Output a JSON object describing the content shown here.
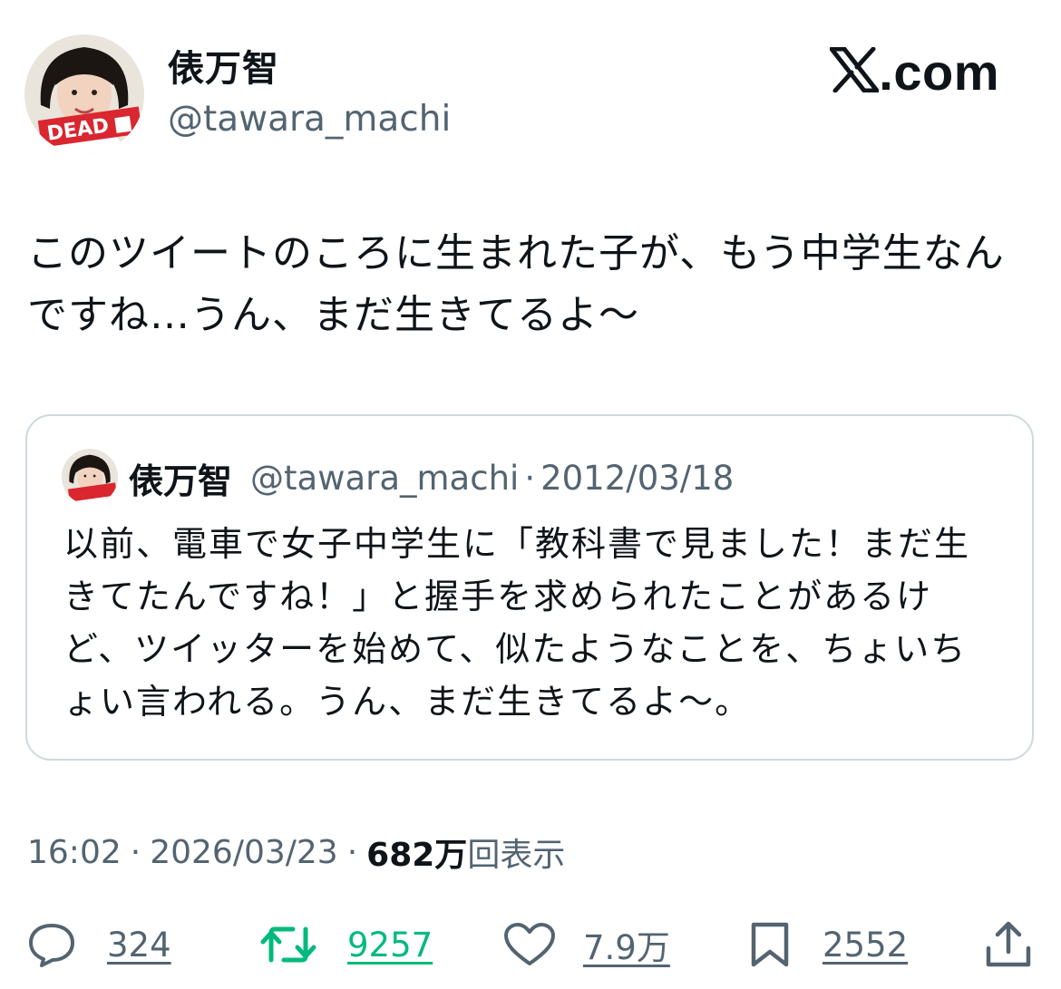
{
  "author": {
    "display_name": "俵万智",
    "handle": "@tawara_machi"
  },
  "avatar": {
    "badge_text": "DEAD",
    "badge_color": "#d9262f"
  },
  "brand": {
    "logo_icon": "x-logo-icon",
    "domain_text": ".com"
  },
  "tweet": {
    "text": "このツイートのころに生まれた子が、もう中学生なんですね…うん、まだ生きてるよ〜"
  },
  "quote": {
    "display_name": "俵万智",
    "handle": "@tawara_machi",
    "separator": "·",
    "date": "2012/03/18",
    "text": "以前、電車で女子中学生に「教科書で見ました！まだ生きてたんですね！」と握手を求められたことがあるけど、ツイッターを始めて、似たようなことを、ちょいちょい言われる。うん、まだ生きてるよ〜。"
  },
  "meta": {
    "time": "16:02",
    "separator": "·",
    "date": "2026/03/23",
    "views_count": "682万",
    "views_label": "回表示"
  },
  "actions": {
    "reply": {
      "icon": "reply-icon",
      "count": "324"
    },
    "retweet": {
      "icon": "retweet-icon",
      "count": "9257",
      "color": "#00ba7c"
    },
    "like": {
      "icon": "heart-icon",
      "count": "7.9万"
    },
    "bookmark": {
      "icon": "bookmark-icon",
      "count": "2552"
    },
    "share": {
      "icon": "share-icon"
    }
  },
  "colors": {
    "text_primary": "#0f1419",
    "text_secondary": "#536471",
    "border": "#cfd9de",
    "retweet_active": "#00ba7c"
  }
}
